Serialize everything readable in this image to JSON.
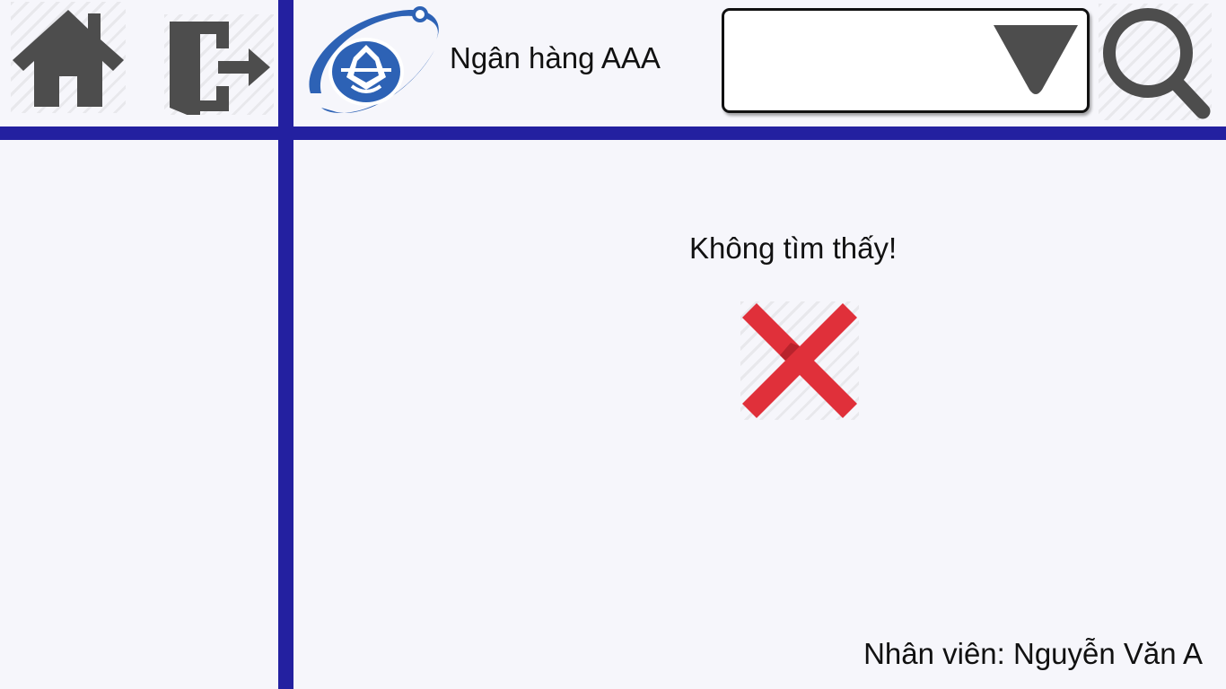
{
  "header": {
    "home_icon": "home-icon",
    "logout_icon": "logout-icon",
    "logo_icon": "bank-logo",
    "bank_name": "Ngân hàng AAA",
    "search_icon": "search-icon",
    "dropdown": {
      "selected_value": "",
      "arrow_icon": "triangle-down-icon"
    }
  },
  "main": {
    "result_message": "Không tìm thấy!",
    "result_icon": "cross-icon",
    "result_color": "#e0303a"
  },
  "footer": {
    "employee_label": "Nhân viên:",
    "employee_name": "Nguyễn Văn A"
  },
  "colors": {
    "accent": "#2320a0",
    "icon": "#4d4d4d",
    "background": "#f6f6fb"
  }
}
